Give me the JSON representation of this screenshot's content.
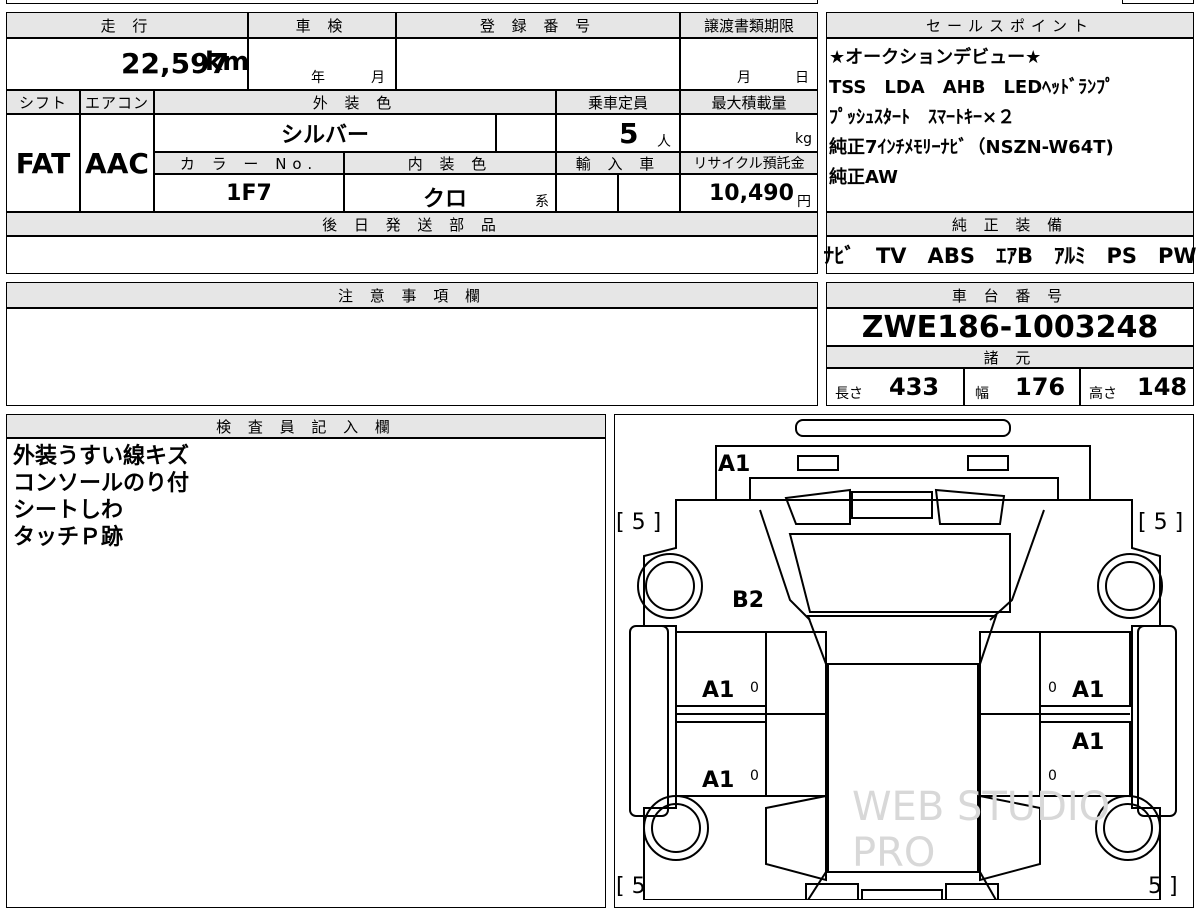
{
  "vehicle": {
    "mileage_label": "走 行",
    "mileage_value": "22,597",
    "mileage_unit": "km",
    "inspection_label": "車 検",
    "inspection_year": "年",
    "inspection_month": "月",
    "registration_label": "登 録 番 号",
    "transfer_label": "譲渡書類期限",
    "transfer_month": "月",
    "transfer_day": "日",
    "shift_label": "シフト",
    "shift_value": "FAT",
    "ac_label": "エアコン",
    "ac_value": "AAC",
    "exterior_color_label": "外 装 色",
    "exterior_color_value": "シルバー",
    "capacity_label": "乗車定員",
    "capacity_value": "5",
    "capacity_unit": "人",
    "max_load_label": "最大積載量",
    "max_load_unit": "kg",
    "color_no_label": "カ ラ ー No.",
    "color_no_value": "1F7",
    "interior_color_label": "内 装 色",
    "interior_color_value": "クロ",
    "interior_color_suffix": "系",
    "import_label": "輸 入 車",
    "recycle_label": "リサイクル預託金",
    "recycle_value": "10,490",
    "recycle_unit": "円",
    "later_parts_label": "後 日 発 送 部 品"
  },
  "sales_points": {
    "header": "セールスポイント",
    "lines": [
      "★オークションデビュー★",
      "TSS　LDA　AHB　LEDﾍｯﾄﾞﾗﾝﾌﾟ",
      "ﾌﾟｯｼｭｽﾀｰﾄ　ｽﾏｰﾄｷｰ×２",
      "純正7ｲﾝﾁﾒﾓﾘｰﾅﾋﾞ（NSZN-W64T)",
      "純正AW"
    ]
  },
  "equipment": {
    "header": "純 正 装 備",
    "items": "ﾅﾋﾞ　TV　ABS　ｴｱB　ｱﾙﾐ　PS　PW"
  },
  "notes": {
    "header": "注 意 事 項 欄"
  },
  "chassis": {
    "header": "車 台 番 号",
    "value": "ZWE186-1003248",
    "specs_header": "諸 元",
    "length_label": "長さ",
    "length_value": "433",
    "width_label": "幅",
    "width_value": "176",
    "height_label": "高さ",
    "height_value": "148"
  },
  "inspector": {
    "header": "検 査 員 記 入 欄",
    "lines": [
      "外装うすい線キズ",
      "コンソールのり付",
      "シートしわ",
      "タッチＰ跡"
    ]
  },
  "diagram": {
    "codes": {
      "front": "A1",
      "hood_left": "B2",
      "left_front_door": "A1",
      "left_rear_door": "A1",
      "right_front_door": "A1",
      "right_rear_door": "A1"
    },
    "tire_front_left": "[ 5 ]",
    "tire_front_right": "[ 5 ]",
    "tire_rear_left": "[ 5",
    "tire_rear_right": "5 ]",
    "zeros": [
      "0",
      "0",
      "0",
      "0"
    ],
    "watermark": "WEB STUDIO PRO"
  }
}
